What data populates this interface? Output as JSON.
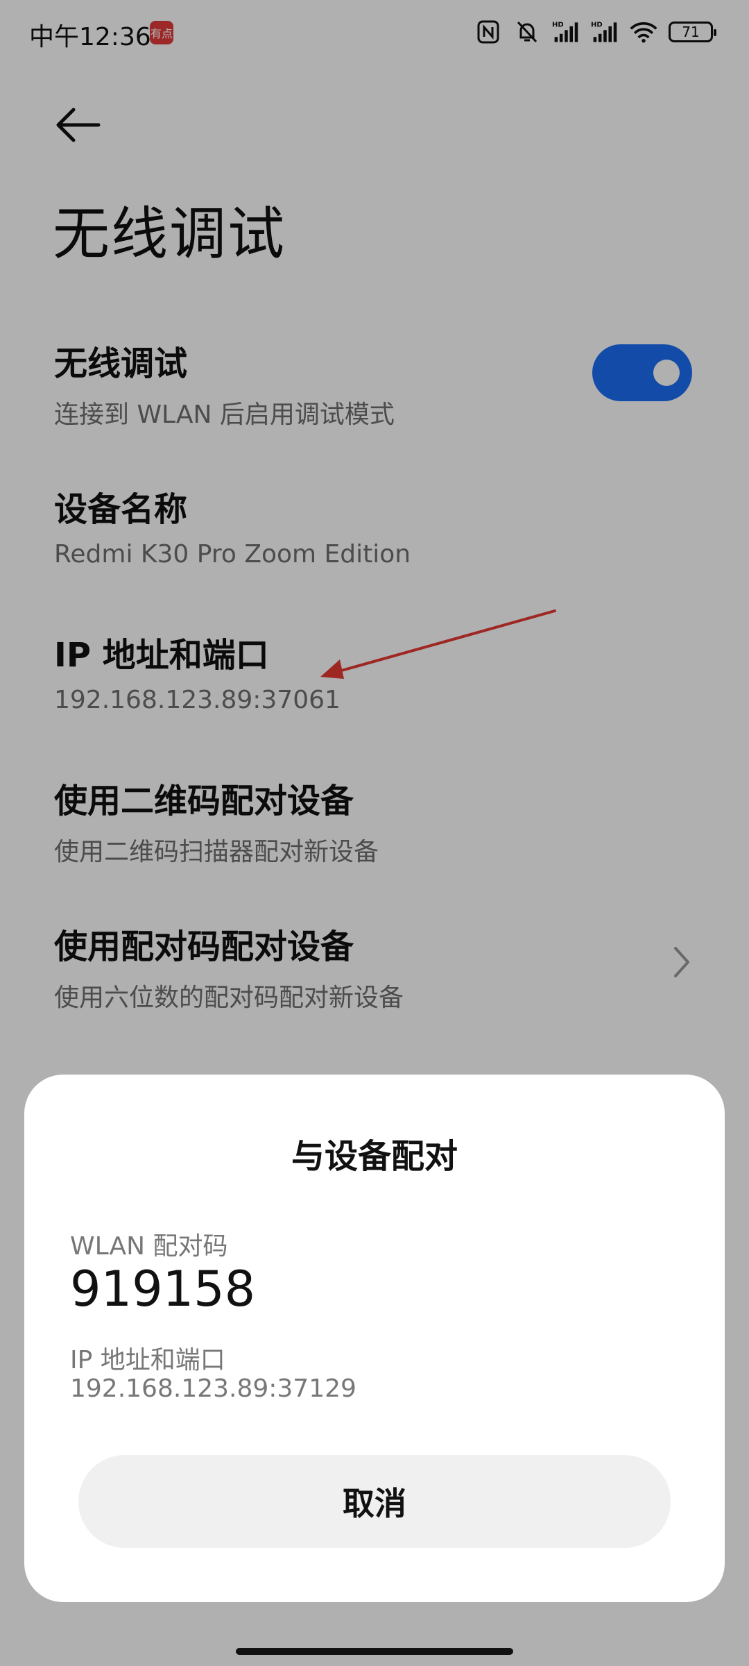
{
  "status_bar": {
    "time": "中午12:36",
    "app_badge_text": "有点",
    "icons": [
      "nfc-icon",
      "bell-muted-icon",
      "signal-hd-icon",
      "signal-hd-icon",
      "wifi-icon",
      "battery-icon"
    ],
    "battery_level": "71"
  },
  "header": {
    "back_icon": "arrow-left-icon",
    "title": "无线调试"
  },
  "settings": [
    {
      "title": "无线调试",
      "subtitle": "连接到 WLAN 后启用调试模式",
      "toggle_on": true
    },
    {
      "title": "设备名称",
      "subtitle": "Redmi K30 Pro Zoom Edition"
    },
    {
      "title": "IP 地址和端口",
      "subtitle": "192.168.123.89:37061"
    },
    {
      "title": "使用二维码配对设备",
      "subtitle": "使用二维码扫描器配对新设备"
    },
    {
      "title": "使用配对码配对设备",
      "subtitle": "使用六位数的配对码配对新设备"
    }
  ],
  "annotation": {
    "color": "#e53935"
  },
  "dialog": {
    "title": "与设备配对",
    "code_label": "WLAN 配对码",
    "code": "919158",
    "ip_label": "IP 地址和端口",
    "ip_value": "192.168.123.89:37129",
    "cancel_label": "取消"
  },
  "colors": {
    "accent": "#1b6ff3",
    "scrim": "rgba(0,0,0,0.31)"
  }
}
